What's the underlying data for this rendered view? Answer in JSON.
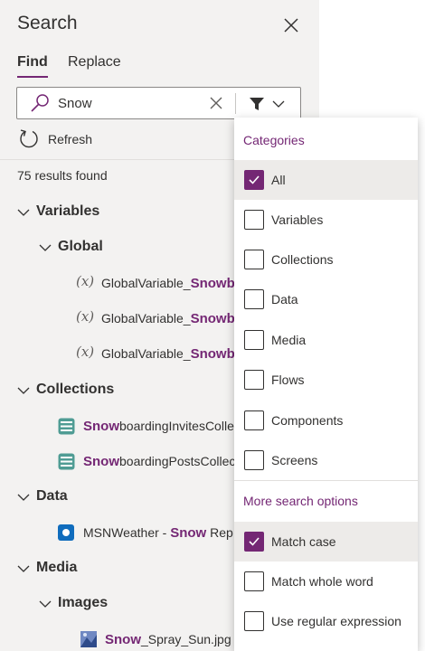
{
  "header": {
    "title": "Search"
  },
  "tabs": [
    {
      "label": "Find",
      "active": true
    },
    {
      "label": "Replace",
      "active": false
    }
  ],
  "search": {
    "value": "Snow"
  },
  "refresh": {
    "label": "Refresh"
  },
  "results": {
    "text": "75 results found"
  },
  "tree": {
    "variables": {
      "label": "Variables",
      "global": {
        "label": "Global",
        "items": [
          {
            "icon": "(x)",
            "prefix": "GlobalVariable_",
            "match": "Snowb"
          },
          {
            "icon": "(x)",
            "prefix": "GlobalVariable_",
            "match": "Snowb"
          },
          {
            "icon": "(x)",
            "prefix": "GlobalVariable_",
            "match": "Snowb"
          }
        ]
      }
    },
    "collections": {
      "label": "Collections",
      "items": [
        {
          "match": "Snow",
          "rest": "boardingInvitesColle"
        },
        {
          "match": "Snow",
          "rest": "boardingPostsCollec"
        }
      ]
    },
    "data": {
      "label": "Data",
      "items": [
        {
          "prefix": "MSNWeather - ",
          "match": "Snow",
          "rest": " Rep"
        }
      ]
    },
    "media": {
      "label": "Media",
      "images": {
        "label": "Images",
        "items": [
          {
            "match": "Snow",
            "rest": "_Spray_Sun.jpg"
          }
        ]
      }
    }
  },
  "dropdown": {
    "categories_heading": "Categories",
    "categories": [
      {
        "label": "All",
        "checked": true
      },
      {
        "label": "Variables",
        "checked": false
      },
      {
        "label": "Collections",
        "checked": false
      },
      {
        "label": "Data",
        "checked": false
      },
      {
        "label": "Media",
        "checked": false
      },
      {
        "label": "Flows",
        "checked": false
      },
      {
        "label": "Components",
        "checked": false
      },
      {
        "label": "Screens",
        "checked": false
      }
    ],
    "options_heading": "More search options",
    "options": [
      {
        "label": "Match case",
        "checked": true
      },
      {
        "label": "Match whole word",
        "checked": false
      },
      {
        "label": "Use regular expression",
        "checked": false
      }
    ]
  },
  "colors": {
    "accent": "#742774",
    "pane_bg": "#f3f2f1",
    "highlight_bg": "#edebe9"
  },
  "icons": {
    "close": "close-icon",
    "search": "search-icon",
    "clear": "clear-icon",
    "filter": "filter-icon",
    "refresh": "refresh-icon",
    "chevron": "chevron-down-icon",
    "variable": "variable-icon",
    "collection": "collection-icon",
    "data_source": "weather-data-icon",
    "image": "image-file-icon",
    "checkbox_checked": "checkmark-icon"
  }
}
